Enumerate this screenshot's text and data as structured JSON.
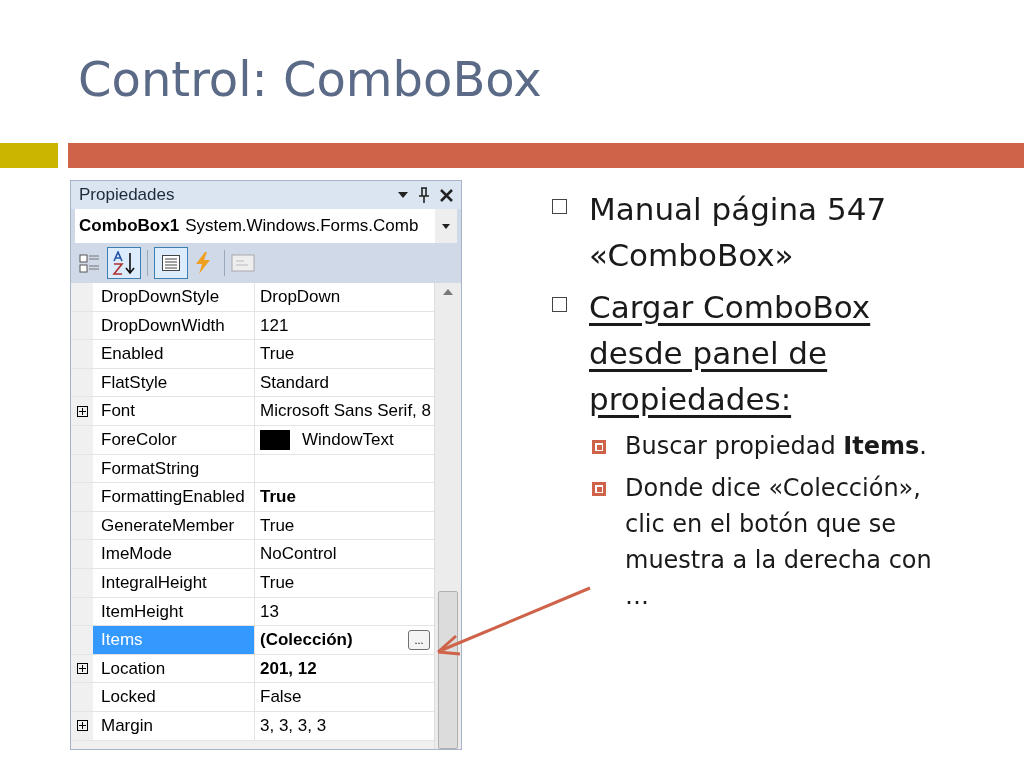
{
  "title": "Control: ComboBox",
  "panel": {
    "title": "Propiedades",
    "object_name": "ComboBox1",
    "object_type": "System.Windows.Forms.Comb",
    "rows": [
      {
        "name": "DropDownStyle",
        "value": "DropDown",
        "selected": false
      },
      {
        "name": "DropDownWidth",
        "value": "121",
        "selected": false
      },
      {
        "name": "Enabled",
        "value": "True",
        "selected": false
      },
      {
        "name": "FlatStyle",
        "value": "Standard",
        "selected": false
      },
      {
        "name": "Font",
        "value": "Microsoft Sans Serif, 8",
        "expandable": true,
        "selected": false
      },
      {
        "name": "ForeColor",
        "value": "WindowText",
        "selected": false,
        "color": "#000000"
      },
      {
        "name": "FormatString",
        "selected": false
      },
      {
        "name": "FormattingEnabled",
        "value": "True",
        "bold": true,
        "selected": false
      },
      {
        "name": "GenerateMember",
        "value": "True",
        "selected": false
      },
      {
        "name": "ImeMode",
        "value": "NoControl",
        "selected": false
      },
      {
        "name": "IntegralHeight",
        "value": "True",
        "selected": false
      },
      {
        "name": "ItemHeight",
        "value": "13",
        "selected": false
      },
      {
        "name": "Items",
        "value": "(Colección)",
        "bold": true,
        "selected": true,
        "button": "..."
      },
      {
        "name": "Location",
        "value": "201, 12",
        "bold": true,
        "expandable": true,
        "selected": false
      },
      {
        "name": "Locked",
        "value": "False",
        "selected": false
      },
      {
        "name": "Margin",
        "value": "3, 3, 3, 3",
        "expandable": true,
        "selected": false
      }
    ]
  },
  "bullets": [
    {
      "text": "Manual página 547 «ComboBox»"
    },
    {
      "text": "Cargar ComboBox desde panel de propiedades:",
      "underlined": true,
      "children": [
        {
          "text": "Buscar propiedad **Items**."
        },
        {
          "text": "Donde dice «Colección», clic en el botón que se muestra a la derecha con …"
        }
      ]
    }
  ]
}
